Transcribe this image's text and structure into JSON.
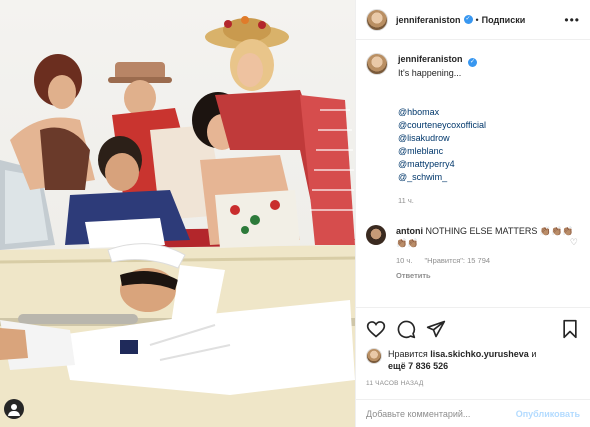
{
  "post": {
    "username": "jenniferaniston",
    "follow_label": "Подписки",
    "more_icon": "more-dots-icon",
    "caption": {
      "username": "jenniferaniston",
      "text": "It's happening...",
      "mentions": [
        "@hbomax",
        "@courteneycoxofficial",
        "@lisakudrow",
        "@mleblanc",
        "@mattyperry4",
        "@_schwim_"
      ],
      "time": "11 ч."
    },
    "comment": {
      "username": "antoni",
      "text": "NOTHING ELSE MATTERS 👏🏽👏🏽👏🏽👏🏽👏🏽",
      "time": "10 ч.",
      "likes": "\"Нравится\": 15 794",
      "reply": "Ответить"
    },
    "liked_by_prefix": "Нравится",
    "liked_by_user": "lisa.skichko.yurusheva",
    "liked_by_suffix": "и",
    "liked_by_count": "ещё 7 836 526",
    "posted_ago": "11 ЧАСОВ НАЗАД",
    "comment_placeholder": "Добавьте комментарий...",
    "publish_label": "Опубликовать"
  },
  "colors": {
    "link": "#00376b",
    "verified": "#3897f0",
    "muted": "#8e8e8e",
    "publish_disabled": "#b3dbff"
  }
}
